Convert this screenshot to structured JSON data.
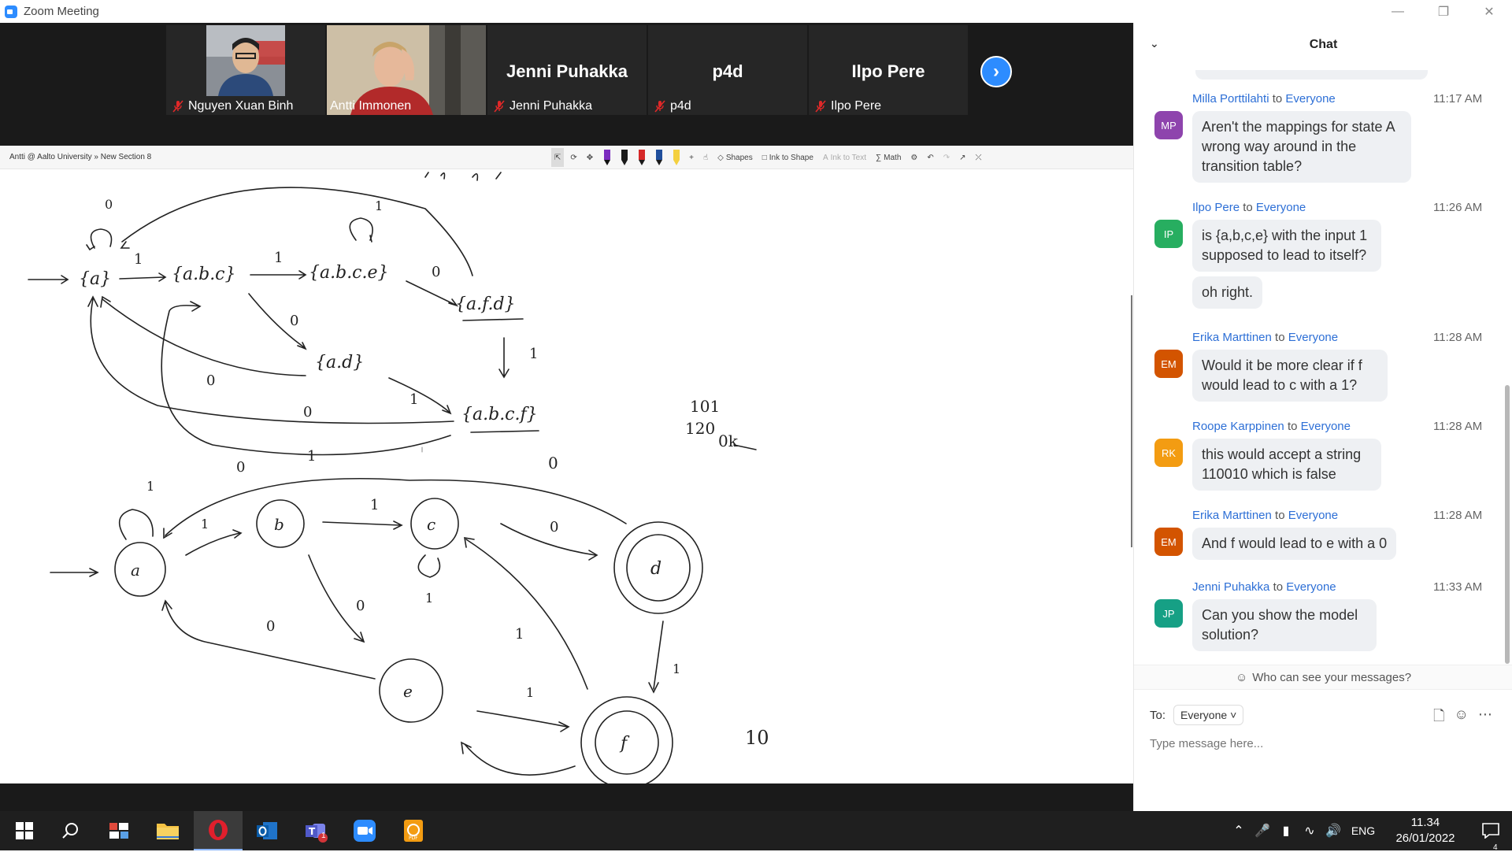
{
  "window": {
    "title": "Zoom Meeting"
  },
  "participants": [
    {
      "name": "Nguyen Xuan Binh",
      "has_video": true,
      "muted": true,
      "active": false
    },
    {
      "name": "Antti Immonen",
      "has_video": true,
      "muted": false,
      "active": true
    },
    {
      "name": "Jenni Puhakka",
      "has_video": false,
      "muted": true,
      "active": false
    },
    {
      "name": "p4d",
      "has_video": false,
      "muted": true,
      "active": false
    },
    {
      "name": "Ilpo Pere",
      "has_video": false,
      "muted": true,
      "active": false
    }
  ],
  "share": {
    "breadcrumb": "Antti @ Aalto University » New Section 8",
    "tools": {
      "shapes": "Shapes",
      "ink_to_shape": "Ink to Shape",
      "ink_to_text": "Ink to Text",
      "math": "Math"
    },
    "pen_colors": [
      "#7b2cbf",
      "#111111",
      "#d62828",
      "#1f4e9c",
      "#f4d03f"
    ],
    "drawing": {
      "dfa_states": [
        "{a}",
        "{a.b.c}",
        "{a.b.c.e}",
        "{a.f.d}",
        "{a.d}",
        "{a.b.c.f}"
      ],
      "nfa_states": [
        "a",
        "b",
        "c",
        "d",
        "e",
        "f"
      ],
      "scribbles": [
        "101",
        "120",
        "0k",
        "10",
        "0",
        "1"
      ]
    }
  },
  "chat": {
    "title": "Chat",
    "messages": [
      {
        "sender": "Milla Porttilahti",
        "to": "to",
        "recipient": "Everyone",
        "time": "11:17 AM",
        "initials": "MP",
        "color": "#8e44ad",
        "bubbles": [
          "Aren't the mappings for state A wrong way around in the transition table?"
        ]
      },
      {
        "sender": "Ilpo Pere",
        "to": "to",
        "recipient": "Everyone",
        "time": "11:26 AM",
        "initials": "IP",
        "color": "#27ae60",
        "bubbles": [
          "is {a,b,c,e} with the input 1 supposed to lead to itself?",
          "oh right."
        ]
      },
      {
        "sender": "Erika Marttinen",
        "to": "to",
        "recipient": "Everyone",
        "time": "11:28 AM",
        "initials": "EM",
        "color": "#d35400",
        "bubbles": [
          "Would it be more clear if f would lead to c with a 1?"
        ]
      },
      {
        "sender": "Roope Karppinen",
        "to": "to",
        "recipient": "Everyone",
        "time": "11:28 AM",
        "initials": "RK",
        "color": "#f39c12",
        "bubbles": [
          "this would accept a string 110010 which is false"
        ]
      },
      {
        "sender": "Erika Marttinen",
        "to": "to",
        "recipient": "Everyone",
        "time": "11:28 AM",
        "initials": "EM",
        "color": "#d35400",
        "bubbles": [
          "And f would lead to e with a 0"
        ]
      },
      {
        "sender": "Jenni Puhakka",
        "to": "to",
        "recipient": "Everyone",
        "time": "11:33 AM",
        "initials": "JP",
        "color": "#16a085",
        "bubbles": [
          "Can you show the model solution?"
        ]
      }
    ],
    "who_can_see": "Who can see your messages?",
    "to_label": "To:",
    "to_value": "Everyone",
    "input_placeholder": "Type message here..."
  },
  "taskbar": {
    "apps": [
      "start",
      "search",
      "task-view",
      "file-explorer",
      "opera",
      "outlook",
      "teams",
      "zoom",
      "pdf-editor"
    ],
    "teams_badge": "1",
    "language": "ENG",
    "time": "11.34",
    "date": "26/01/2022",
    "notifications": "4"
  }
}
